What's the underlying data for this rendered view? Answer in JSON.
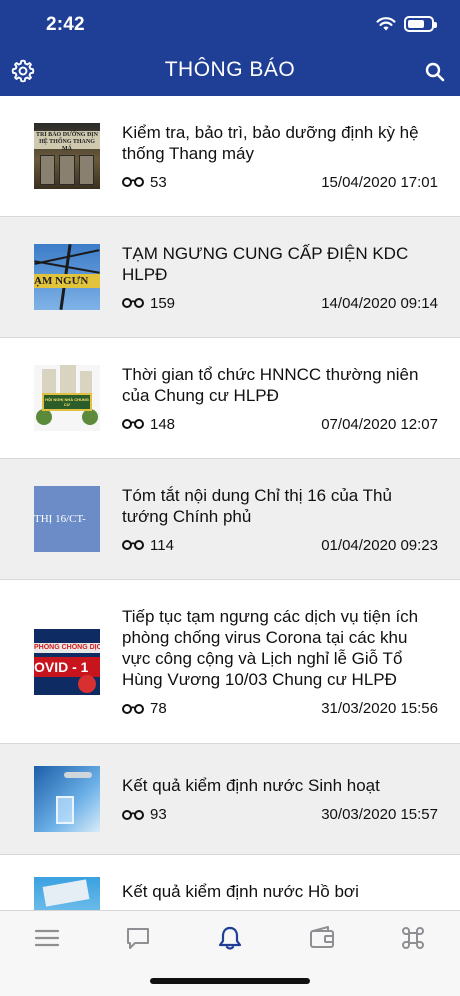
{
  "status": {
    "time": "2:42",
    "battery_level": 0.6
  },
  "nav": {
    "title": "THÔNG BÁO",
    "left_icon": "gear-icon",
    "right_icon": "search-icon"
  },
  "list": [
    {
      "title": "Kiểm tra, bảo trì, bảo dưỡng định kỳ hệ thống Thang máy",
      "views": "53",
      "date": "15/04/2020 17:01",
      "thumb_text": "TRÌ BẢO DƯỠNG ĐỊN HỆ THỐNG THANG MÁ"
    },
    {
      "title": "TẠM NGƯNG CUNG CẤP ĐIỆN KDC HLPĐ",
      "views": "159",
      "date": "14/04/2020 09:14",
      "thumb_text": "ẠM NGƯN"
    },
    {
      "title": "Thời gian tổ chức HNNCC thường niên của Chung cư HLPĐ",
      "views": "148",
      "date": "07/04/2020 12:07",
      "thumb_text": "HỘI NGHỊ NHÀ CHUNG CƯ"
    },
    {
      "title": "Tóm tắt nội dung Chỉ thị 16 của Thủ tướng Chính phủ",
      "views": "114",
      "date": "01/04/2020 09:23",
      "thumb_text": "THỊ 16/CT-"
    },
    {
      "title": "Tiếp tục tạm ngưng các dịch vụ tiện ích phòng chống virus Corona tại các khu vực công cộng và Lịch nghỉ lễ Giỗ Tổ Hùng Vương 10/03 Chung cư HLPĐ",
      "views": "78",
      "date": "31/03/2020 15:56",
      "thumb_text": "PHÒNG CHỐNG DỊCH BỆNH",
      "thumb_text2": "OVID - 1"
    },
    {
      "title": "Kết quả kiểm định nước Sinh hoạt",
      "views": "93",
      "date": "30/03/2020 15:57"
    },
    {
      "title": "Kết quả kiểm định nước Hồ bơi"
    }
  ],
  "tabs": [
    {
      "name": "menu",
      "icon": "menu-icon",
      "active": false
    },
    {
      "name": "chat",
      "icon": "chat-icon",
      "active": false
    },
    {
      "name": "notifications",
      "icon": "bell-icon",
      "active": true
    },
    {
      "name": "wallet",
      "icon": "wallet-icon",
      "active": false
    },
    {
      "name": "command",
      "icon": "command-icon",
      "active": false
    }
  ],
  "colors": {
    "header": "#1f3f96",
    "active_tab": "#1f3f96",
    "inactive_tab": "#8e8e93",
    "row_alt": "#efefef"
  }
}
